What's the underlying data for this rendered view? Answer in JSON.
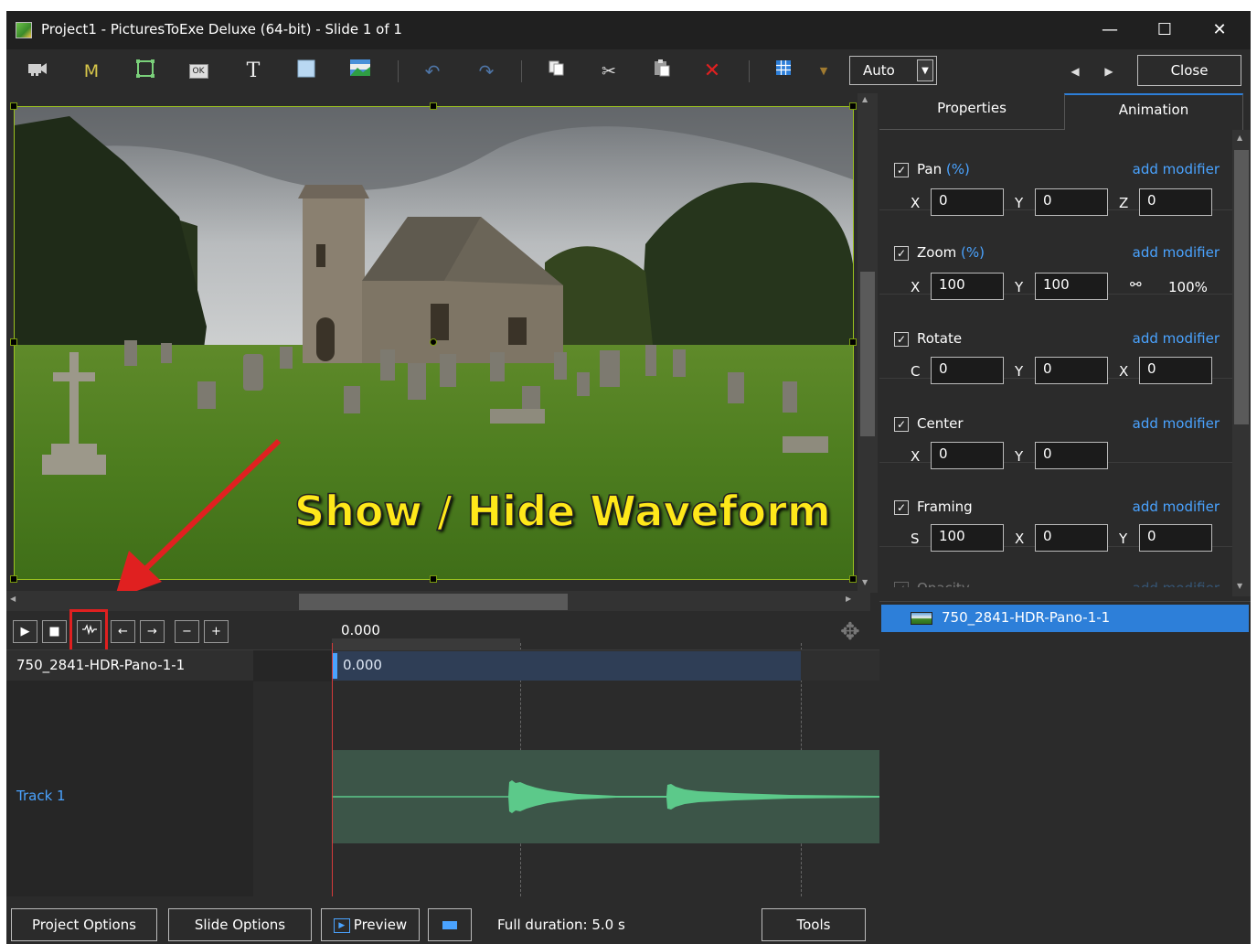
{
  "window": {
    "title": "Project1 - PicturesToExe Deluxe (64-bit) - Slide 1 of 1",
    "minimize": "—",
    "maximize": "☐",
    "close": "✕"
  },
  "toolbar": {
    "m_label": "M",
    "ok_label": "OK",
    "t_label": "T",
    "auto_value": "Auto",
    "close_label": "Close"
  },
  "canvas": {
    "annotation": "Show / Hide Waveform"
  },
  "panel": {
    "tabs": [
      "Properties",
      "Animation"
    ],
    "active_tab": "Animation",
    "add_modifier": "add modifier",
    "groups": [
      {
        "label": "Pan",
        "unit": "(%)",
        "fields": [
          {
            "l": "X",
            "v": "0"
          },
          {
            "l": "Y",
            "v": "0"
          },
          {
            "l": "Z",
            "v": "0"
          }
        ]
      },
      {
        "label": "Zoom",
        "unit": "(%)",
        "fields": [
          {
            "l": "X",
            "v": "100"
          },
          {
            "l": "Y",
            "v": "100"
          }
        ],
        "link_value": "100%"
      },
      {
        "label": "Rotate",
        "unit": "",
        "fields": [
          {
            "l": "C",
            "v": "0"
          },
          {
            "l": "Y",
            "v": "0"
          },
          {
            "l": "X",
            "v": "0"
          }
        ]
      },
      {
        "label": "Center",
        "unit": "",
        "fields": [
          {
            "l": "X",
            "v": "0"
          },
          {
            "l": "Y",
            "v": "0"
          }
        ]
      },
      {
        "label": "Framing",
        "unit": "",
        "fields": [
          {
            "l": "S",
            "v": "100"
          },
          {
            "l": "X",
            "v": "0"
          },
          {
            "l": "Y",
            "v": "0"
          }
        ]
      },
      {
        "label": "Opacity",
        "unit": "",
        "fields": []
      }
    ],
    "slide_item": "750_2841-HDR-Pano-1-1"
  },
  "timeline": {
    "time": "0.000",
    "slide_name": "750_2841-HDR-Pano-1-1",
    "slide_time": "0.000",
    "track_name": "Track 1"
  },
  "bottombar": {
    "project_options": "Project Options",
    "slide_options": "Slide Options",
    "preview": "Preview",
    "duration": "Full duration: 5.0 s",
    "tools": "Tools"
  },
  "colors": {
    "accent": "#2d7fd9",
    "link": "#4aa3ff",
    "highlight_box": "#e02020",
    "annotation": "#ffe81a",
    "waveform": "#5cc98a"
  }
}
